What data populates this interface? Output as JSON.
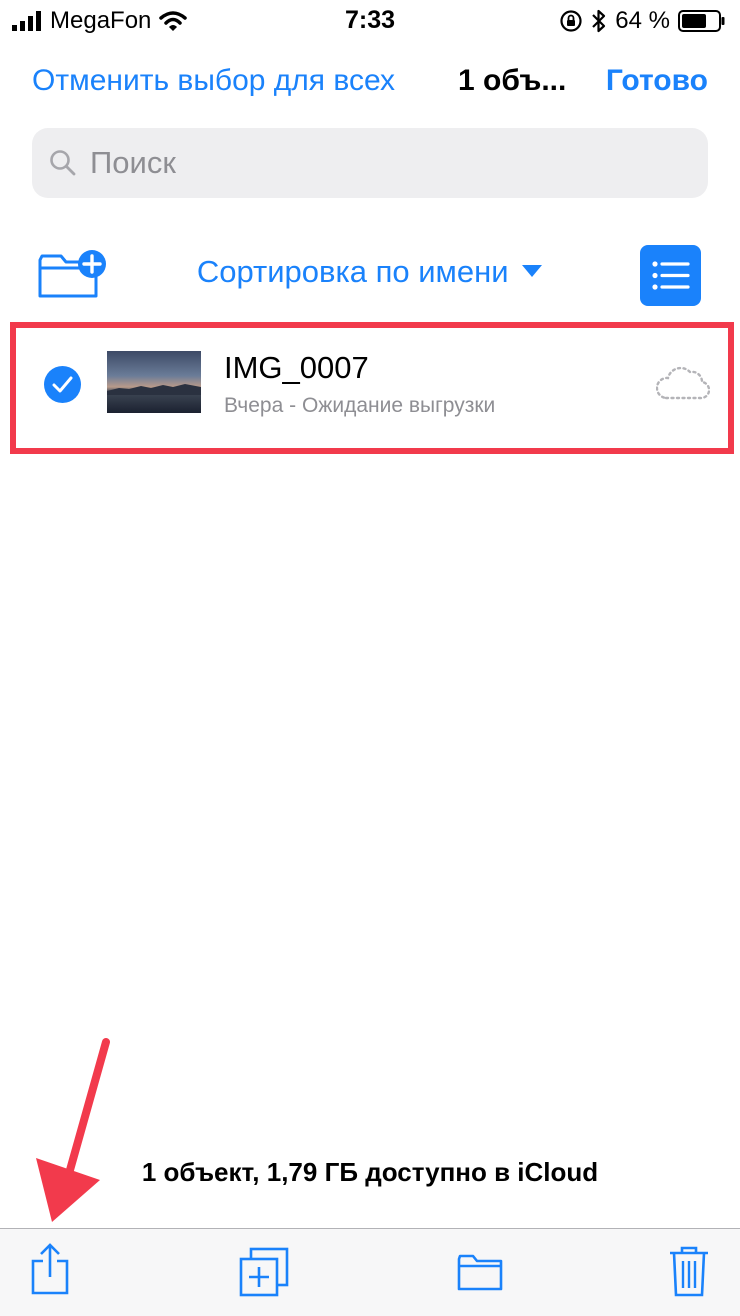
{
  "status_bar": {
    "carrier": "MegaFon",
    "time": "7:33",
    "battery": "64 %"
  },
  "nav": {
    "cancel_label": "Отменить выбор для всех",
    "title": "1 объ...",
    "done_label": "Готово"
  },
  "search": {
    "placeholder": "Поиск"
  },
  "toolbar": {
    "sort_label": "Сортировка по имени"
  },
  "files": [
    {
      "name": "IMG_0007",
      "status": "Вчера - Ожидание выгрузки",
      "selected": true
    }
  ],
  "footer": {
    "storage_info": "1 объект, 1,79 ГБ доступно в iCloud"
  },
  "icons": {
    "signal": "signal-bars-icon",
    "wifi": "wifi-icon",
    "rotation_lock": "rotation-lock-icon",
    "bluetooth": "bluetooth-icon",
    "battery": "battery-icon",
    "search": "search-icon",
    "new_folder": "folder-plus-icon",
    "sort_caret": "caret-down-icon",
    "list_view": "list-icon",
    "checkmark": "checkmark-icon",
    "cloud_pending": "cloud-dotted-icon",
    "share": "share-icon",
    "duplicate": "duplicate-icon",
    "move": "folder-icon",
    "delete": "trash-icon"
  },
  "colors": {
    "accent": "#1a82fb",
    "highlight": "#f23a4c",
    "secondary_text": "#8e8e93"
  }
}
